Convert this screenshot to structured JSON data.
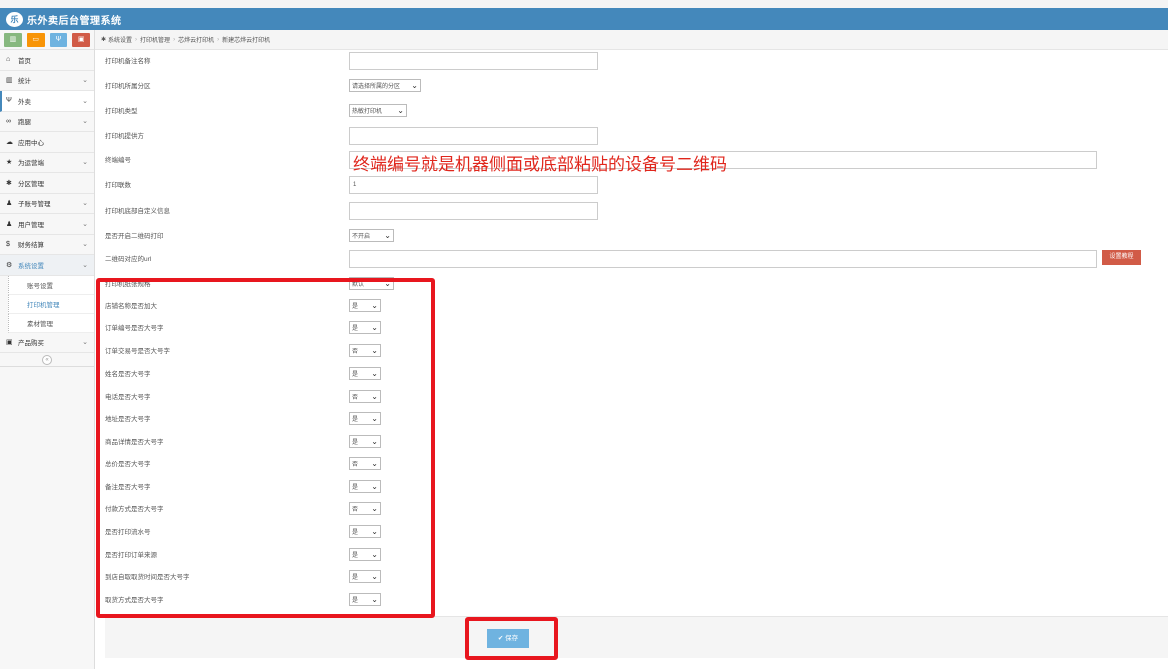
{
  "header": {
    "logo_text": "乐",
    "title": "乐外卖后台管理系统"
  },
  "quick_buttons": [
    {
      "icon": "chart-icon",
      "glyph": "▥",
      "color": "#87b87f"
    },
    {
      "icon": "monitor-icon",
      "glyph": "▭",
      "color": "#f89406"
    },
    {
      "icon": "utensils-icon",
      "glyph": "Ψ",
      "color": "#6fb3e0"
    },
    {
      "icon": "briefcase-icon",
      "glyph": "▣",
      "color": "#d15b47"
    }
  ],
  "sidebar": {
    "items": [
      {
        "label": "首页",
        "glyph": "⌂"
      },
      {
        "label": "统计",
        "glyph": "▥",
        "has_arrow": true
      },
      {
        "label": "外卖",
        "glyph": "Ψ",
        "has_arrow": true
      },
      {
        "label": "跑腿",
        "glyph": "∞",
        "has_arrow": true
      },
      {
        "label": "应用中心",
        "glyph": "☁"
      },
      {
        "label": "为运营端",
        "glyph": "★",
        "has_arrow": true
      },
      {
        "label": "分区管理",
        "glyph": "✱"
      },
      {
        "label": "子账号管理",
        "glyph": "♟",
        "has_arrow": true
      },
      {
        "label": "用户管理",
        "glyph": "♟",
        "has_arrow": true
      },
      {
        "label": "财务结算",
        "glyph": "$",
        "has_arrow": true
      },
      {
        "label": "系统设置",
        "glyph": "⚙",
        "has_arrow": true
      }
    ],
    "sub_items": [
      "账号设置",
      "打印机管理",
      "素材管理"
    ],
    "after_items": [
      {
        "label": "产品购买",
        "glyph": "▣",
        "has_arrow": true
      }
    ],
    "arrow": "⌄",
    "collapse_glyph": "«"
  },
  "breadcrumb": {
    "icon_glyph": "✱",
    "items": [
      "系统设置",
      "打印机管理",
      "芯烨云打印机",
      "新建芯烨云打印机"
    ],
    "separator": "›"
  },
  "form": {
    "fields": [
      {
        "label": "打印机备注名称",
        "type": "input",
        "value": ""
      },
      {
        "label": "打印机所属分区",
        "type": "select",
        "value": "请选择所属的分区"
      },
      {
        "label": "打印机类型",
        "type": "select",
        "value": "热敏打印机"
      },
      {
        "label": "打印机提供方",
        "type": "input",
        "value": ""
      },
      {
        "label": "终端编号",
        "type": "input-wide",
        "value": ""
      },
      {
        "label": "打印联数",
        "type": "input",
        "value": "1"
      },
      {
        "label": "打印机底部自定义信息",
        "type": "input",
        "value": ""
      },
      {
        "label": "是否开启二维码打印",
        "type": "select",
        "value": "不开启"
      },
      {
        "label": "二维码对应的url",
        "type": "input-full",
        "value": ""
      },
      {
        "label": "打印机纸张规格",
        "type": "select",
        "value": "默认"
      },
      {
        "label": "店铺名称是否加大",
        "type": "select",
        "value": "是"
      },
      {
        "label": "订单编号是否大号字",
        "type": "select",
        "value": "是"
      },
      {
        "label": "订单交易号是否大号字",
        "type": "select",
        "value": "否"
      },
      {
        "label": "姓名是否大号字",
        "type": "select",
        "value": "是"
      },
      {
        "label": "电话是否大号字",
        "type": "select",
        "value": "否"
      },
      {
        "label": "地址是否大号字",
        "type": "select",
        "value": "是"
      },
      {
        "label": "商品详情是否大号字",
        "type": "select",
        "value": "是"
      },
      {
        "label": "总价是否大号字",
        "type": "select",
        "value": "否"
      },
      {
        "label": "备注是否大号字",
        "type": "select",
        "value": "是"
      },
      {
        "label": "付款方式是否大号字",
        "type": "select",
        "value": "否"
      },
      {
        "label": "是否打印流水号",
        "type": "select",
        "value": "是"
      },
      {
        "label": "是否打印订单来源",
        "type": "select",
        "value": "是"
      },
      {
        "label": "到店自取取货时间是否大号字",
        "type": "select",
        "value": "是"
      },
      {
        "label": "取货方式是否大号字",
        "type": "select",
        "value": "是"
      }
    ],
    "help_text": "终端编号就是机器侧面或底部粘贴的设备号二维码",
    "tutorial_button": "设置教程",
    "select_arrow": "⌄"
  },
  "footer": {
    "save_label": "✔ 保存"
  },
  "colors": {
    "accent": "#4488bb",
    "highlight": "#e8161e",
    "save": "#6fb3e0",
    "tutorial": "#d15b47"
  }
}
